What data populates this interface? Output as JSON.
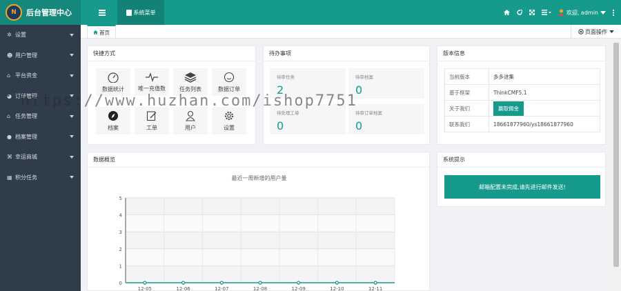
{
  "app": {
    "title": "后台管理中心",
    "logo_text": "N"
  },
  "topbar": {
    "menu_toggle_icon": "list-icon",
    "system_menu": "系统菜单",
    "welcome": "欢迎, admin"
  },
  "sidebar": {
    "items": [
      {
        "label": "设置",
        "icon": "cogs-icon"
      },
      {
        "label": "用户管理",
        "icon": "users-icon"
      },
      {
        "label": "平台资金",
        "icon": "bank-icon"
      },
      {
        "label": "订单管理",
        "icon": "chart-icon"
      },
      {
        "label": "任务管理",
        "icon": "bank-icon"
      },
      {
        "label": "档案管理",
        "icon": "circle-icon"
      },
      {
        "label": "幸运商城",
        "icon": "shop-icon"
      },
      {
        "label": "积分任务",
        "icon": "grid-icon"
      }
    ]
  },
  "tabs": {
    "home": "首页",
    "page_ops": "页面操作"
  },
  "shortcuts": {
    "title": "快捷方式",
    "items": [
      {
        "label": "数据统计"
      },
      {
        "label": "唯一充值数"
      },
      {
        "label": "任务列表"
      },
      {
        "label": "数据订单"
      },
      {
        "label": "档案"
      },
      {
        "label": "工单"
      },
      {
        "label": "用户"
      },
      {
        "label": "设置"
      }
    ]
  },
  "todo": {
    "title": "待办事项",
    "items": [
      {
        "label": "待审任务",
        "value": "2"
      },
      {
        "label": "待审档案",
        "value": "0"
      },
      {
        "label": "待处理工单",
        "value": "0"
      },
      {
        "label": "待审订单档案",
        "value": "0"
      }
    ]
  },
  "version": {
    "title": "版本信息",
    "rows": [
      {
        "key": "当前版本",
        "value": "多多进集"
      },
      {
        "key": "基于框架",
        "value": "ThinkCMF5.1"
      },
      {
        "key": "关于我们",
        "button": "赢取佣金"
      },
      {
        "key": "联系我们",
        "value": "18661877960/ys18661877960"
      }
    ]
  },
  "overview": {
    "title": "数据概览",
    "chart_title": "最近一周新增的用户量"
  },
  "sysnote": {
    "title": "系统提示",
    "banner": "邮箱配置未完成,请先进行邮件发送!"
  },
  "watermark": "https://www.huzhan.com/ishop7751",
  "chart_data": {
    "type": "line",
    "x": [
      "12-05",
      "12-06",
      "12-07",
      "12-08",
      "12-09",
      "12-10",
      "12-11"
    ],
    "series": [
      {
        "values": [
          0,
          0,
          0,
          0,
          0,
          0,
          0
        ]
      }
    ],
    "ylim": [
      0,
      5
    ],
    "yticks": [
      "0",
      "1",
      "2",
      "3",
      "4",
      "5"
    ],
    "color": "#169a8c",
    "grid": true
  },
  "colors": {
    "primary": "#169a8c",
    "sidebar": "#2f3d4a"
  }
}
